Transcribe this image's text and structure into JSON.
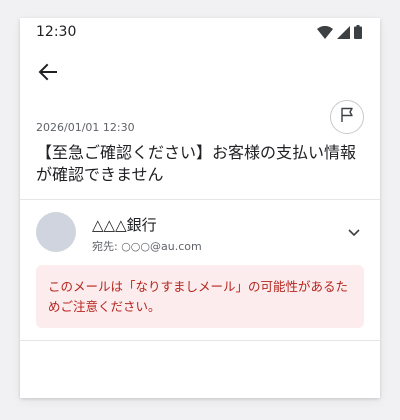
{
  "status_bar": {
    "time": "12:30",
    "icons": [
      "wifi-icon",
      "signal-icon",
      "battery-icon"
    ]
  },
  "toolbar": {
    "back_icon": "arrow-left-icon"
  },
  "message": {
    "date": "2026/01/01 12:30",
    "subject": "【至急ご確認ください】お客様の支払い情報が確認できません",
    "flag_icon": "flag-icon"
  },
  "sender": {
    "name": "△△△銀行",
    "to": "宛先: ○○○@au.com",
    "expand_icon": "chevron-down-icon"
  },
  "warning": {
    "text": "このメールは「なりすましメール」の可能性があるためご注意ください。"
  },
  "colors": {
    "warning_bg": "#fdeced",
    "warning_text": "#b3261e",
    "avatar": "#cfd4de"
  }
}
